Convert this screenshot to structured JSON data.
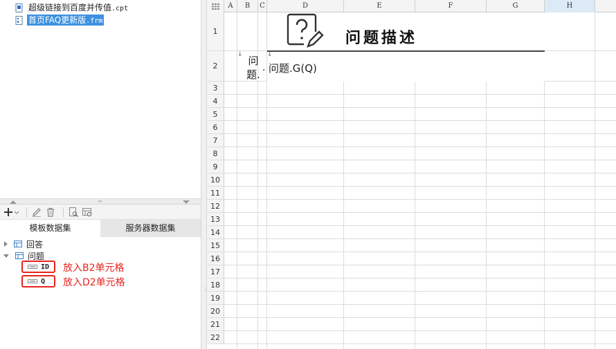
{
  "file_tree": {
    "items": [
      {
        "name": "超级链接到百度并传值",
        "ext": ".cpt",
        "selected": false
      },
      {
        "name": "首页FAQ更新版",
        "ext": ".frm",
        "selected": true
      }
    ]
  },
  "toolbar": {
    "add_icon": "plus-icon",
    "edit_icon": "pencil-icon",
    "delete_icon": "trash-icon",
    "preview_icon": "preview-icon",
    "server_icon": "dataset-server-icon"
  },
  "ds_tabs": [
    {
      "label": "模板数据集",
      "active": true
    },
    {
      "label": "服务器数据集",
      "active": false
    }
  ],
  "datasets": [
    {
      "name": "回答",
      "expanded": false
    },
    {
      "name": "问题",
      "expanded": true,
      "fields": [
        "ID",
        "Q"
      ]
    }
  ],
  "annotations": [
    "放入B2单元格",
    "放入D2单元格"
  ],
  "sheet": {
    "columns": [
      "A",
      "B",
      "C",
      "D",
      "E",
      "F",
      "G",
      "H"
    ],
    "selected_column": "H",
    "rows": [
      "1",
      "2",
      "3",
      "4",
      "5",
      "6",
      "7",
      "8",
      "9",
      "10",
      "11",
      "12",
      "13",
      "14",
      "15",
      "16",
      "17",
      "18",
      "19",
      "20",
      "21",
      "22"
    ],
    "title": "问题描述",
    "b2": "问题.",
    "b2_line1": "问",
    "b2_line2": "题.",
    "c2": ".",
    "d2": "问题.G(Q)"
  },
  "colors": {
    "accent": "#3e91e0",
    "annotation": "#e8231c",
    "selected_col": "#dbeaf6"
  }
}
